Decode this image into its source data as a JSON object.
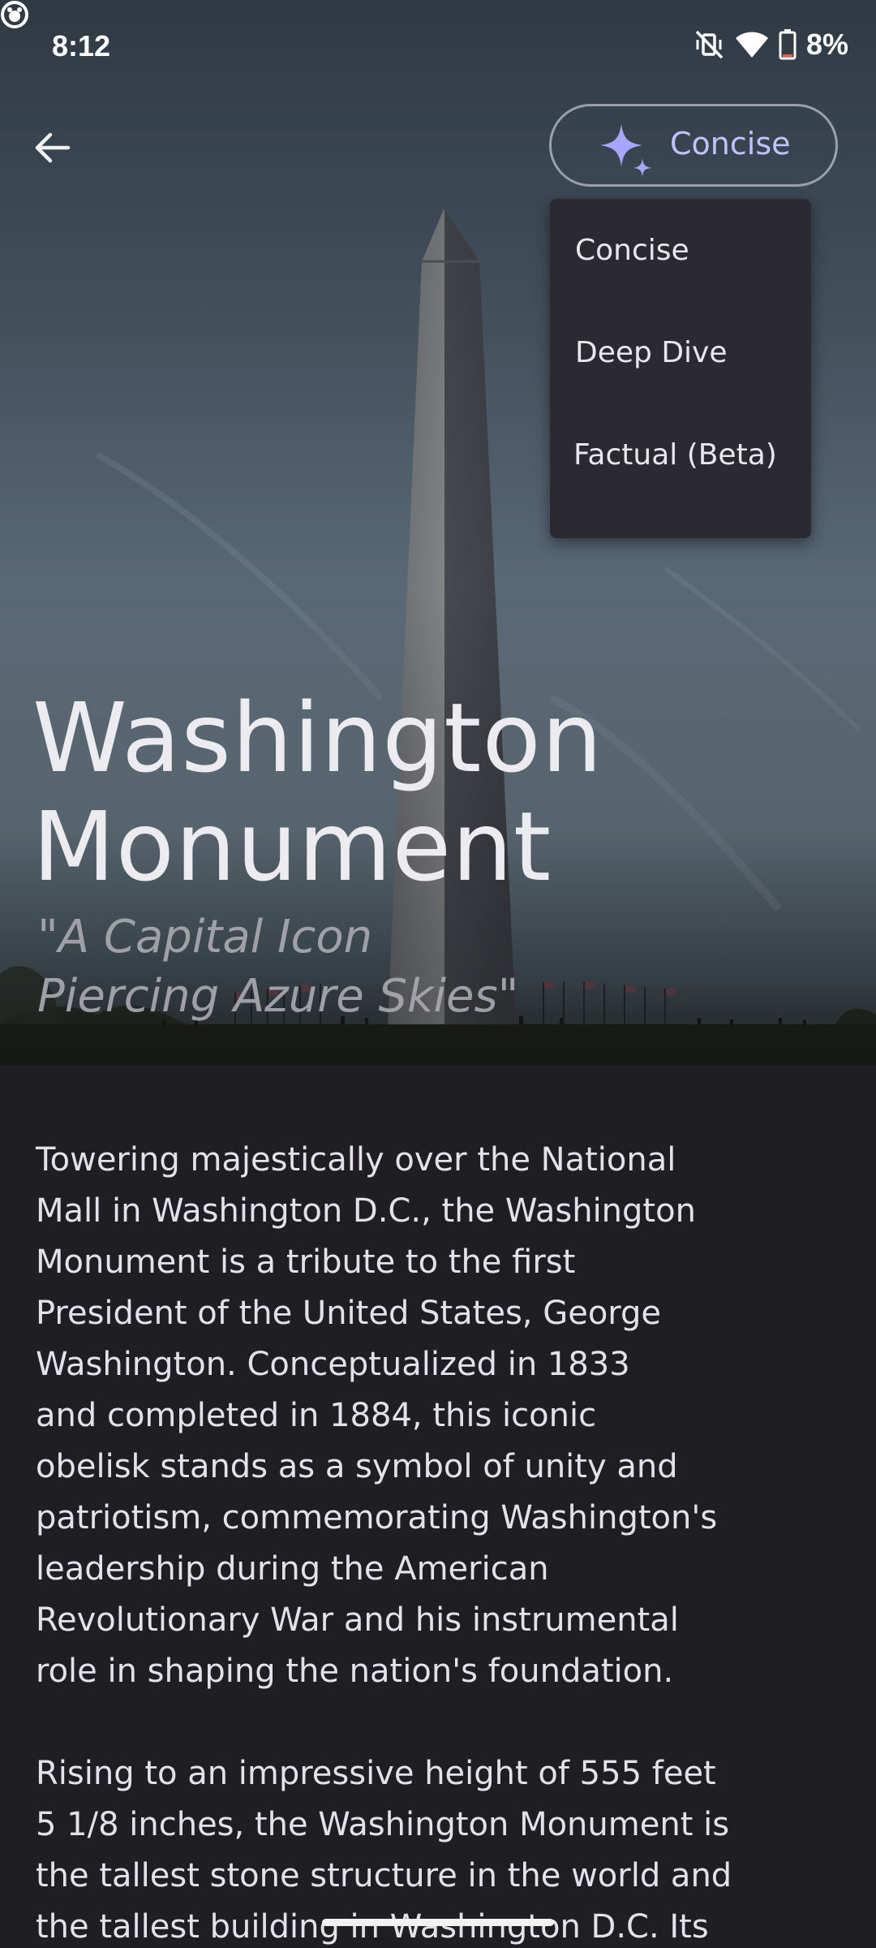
{
  "status_bar": {
    "time": "8:12",
    "battery_percent": "8%",
    "icons": [
      "app-notification-icon",
      "vibrate-off-icon",
      "wifi-icon",
      "battery-icon"
    ]
  },
  "top_bar": {
    "back_icon": "arrow-back-icon",
    "mode_chip": {
      "icon": "sparkle-icon",
      "label": "Concise"
    }
  },
  "mode_menu": {
    "items": [
      {
        "label": "Concise"
      },
      {
        "label": "Deep Dive"
      },
      {
        "label": "Factual (Beta)"
      }
    ]
  },
  "hero": {
    "title_line1": "Washington",
    "title_line2": "Monument",
    "subtitle_line1": "\"A Capital Icon",
    "subtitle_line2": "Piercing Azure Skies\""
  },
  "article": {
    "paragraph1": "Towering majestically over the National\nMall in Washington D.C., the Washington\nMonument is a tribute to the first\nPresident of the United States, George\nWashington. Conceptualized in 1833\nand completed in 1884, this iconic\nobelisk stands as a symbol of unity and\npatriotism, commemorating Washington's\nleadership during the American\nRevolutionary War and his instrumental\nrole in shaping the nation's foundation.",
    "paragraph2": "Rising to an impressive height of 555 feet\n5 1/8 inches, the Washington Monument is\nthe tallest stone structure in the world and\nthe tallest building in Washington D.C. Its"
  },
  "colors": {
    "accent": "#c3c1ff",
    "background": "#1f1e23",
    "menu_background": "#2b2a33"
  }
}
